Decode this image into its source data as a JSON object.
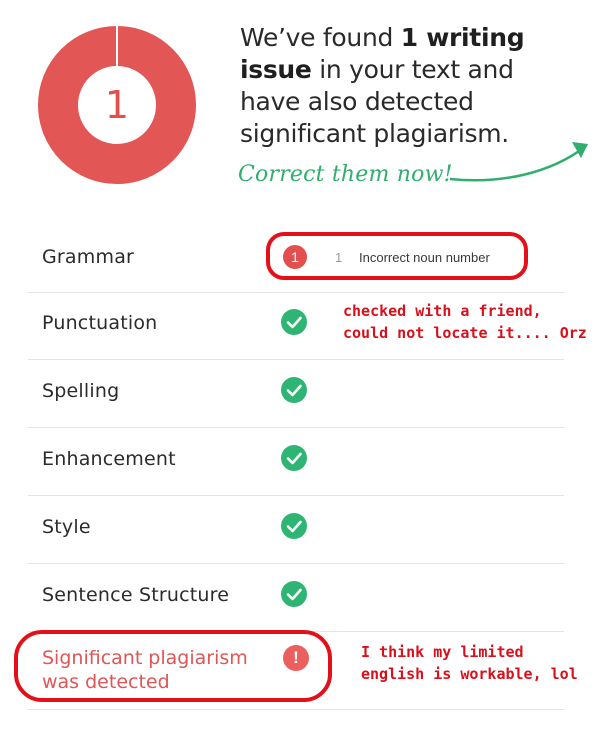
{
  "summary": {
    "issue_count": "1",
    "text_prefix": "We’ve found ",
    "text_bold": "1 writing issue",
    "text_suffix": " in your text and have also detected significant plagiarism.",
    "cta": "Correct them now!"
  },
  "categories": [
    {
      "label": "Grammar",
      "status": "issue"
    },
    {
      "label": "Punctuation",
      "status": "ok"
    },
    {
      "label": "Spelling",
      "status": "ok"
    },
    {
      "label": "Enhancement",
      "status": "ok"
    },
    {
      "label": "Style",
      "status": "ok"
    },
    {
      "label": "Sentence Structure",
      "status": "ok"
    }
  ],
  "grammar_issue": {
    "badge": "1",
    "count": "1",
    "text": "Incorrect noun number"
  },
  "plagiarism": {
    "label": "Significant plagiarism was detected",
    "badge": "!"
  },
  "annotations": {
    "note1_line1": "checked with a friend,",
    "note1_line2": "could not locate it....  Orz",
    "note2_line1": "I think my limited",
    "note2_line2": "english is workable, lol"
  },
  "colors": {
    "error": "#e24f4f",
    "success": "#2fb573",
    "accent_green": "#2fae6e",
    "annotation_red": "#e3101a"
  }
}
